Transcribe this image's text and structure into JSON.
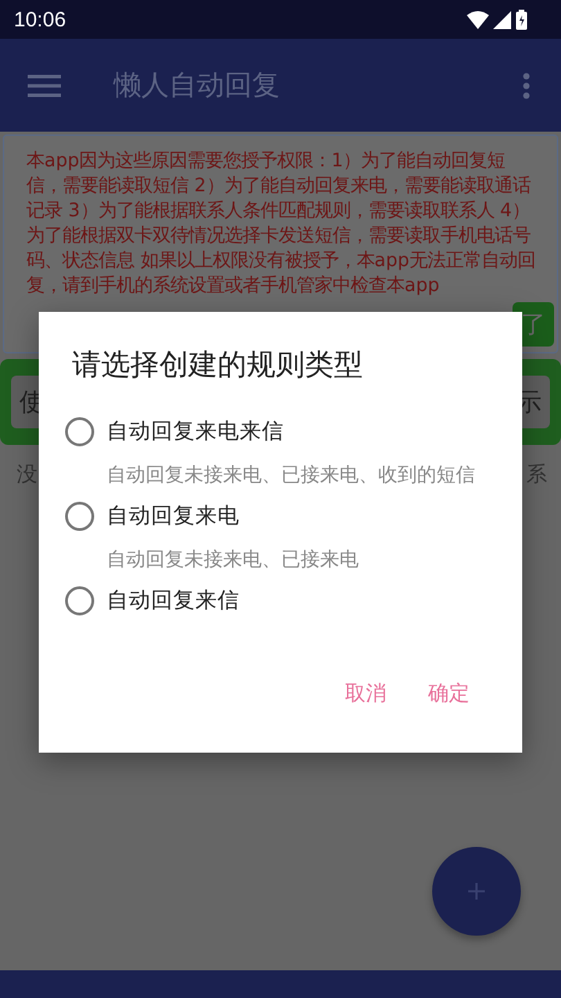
{
  "status_bar": {
    "time": "10:06"
  },
  "app_bar": {
    "title": "懒人自动回复"
  },
  "permission_card": {
    "text": "本app因为这些原因需要您授予权限：1）为了能自动回复短信，需要能读取短信 2）为了能自动回复来电，需要能读取通话记录 3）为了能根据联系人条件匹配规则，需要读取联系人 4）为了能根据双卡双待情况选择卡发送短信，需要读取手机电话号码、状态信息 如果以上权限没有被授予，本app无法正常自动回复，请到手机的系统设置或者手机管家中检查本app",
    "button": "了"
  },
  "action_row": {
    "buttons": [
      "使",
      "示"
    ]
  },
  "info_row": {
    "texts": [
      "没",
      "系"
    ]
  },
  "dialog": {
    "title": "请选择创建的规则类型",
    "options": [
      {
        "label": "自动回复来电来信",
        "description": "自动回复未接来电、已接来电、收到的短信",
        "selected": false
      },
      {
        "label": "自动回复来电",
        "description": "自动回复未接来电、已接来电",
        "selected": false
      },
      {
        "label": "自动回复来信",
        "selected": false
      }
    ],
    "buttons": [
      "取消",
      "确定"
    ]
  }
}
